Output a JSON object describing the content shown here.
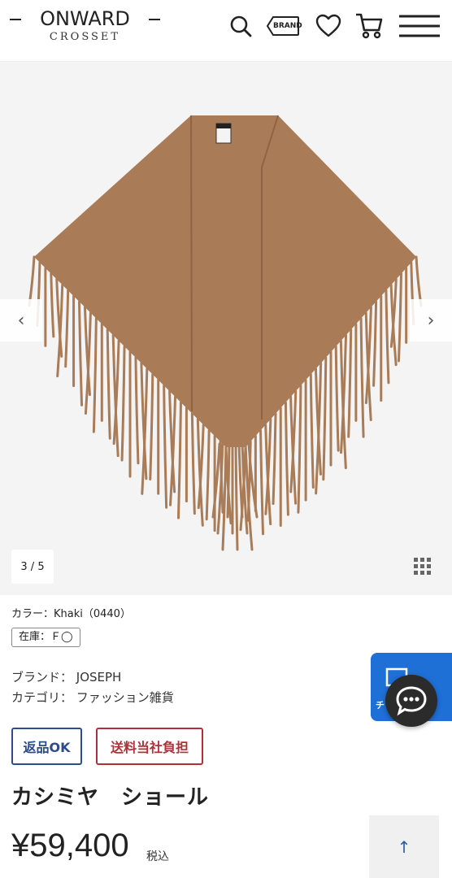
{
  "header": {
    "logo_main": "ONWARD",
    "logo_sub": "CROSSET",
    "brand_label": "BRAND",
    "icons": [
      "search-icon",
      "brand-icon",
      "heart-icon",
      "cart-icon",
      "menu-icon"
    ]
  },
  "gallery": {
    "counter": "3 / 5",
    "prev_label": "‹",
    "next_label": "›",
    "shawl_color": "#a97c57"
  },
  "product": {
    "color_line": "カラー：Khaki（0440）",
    "stock": "在庫：Ｆ◯",
    "brand_line": "ブランド：  JOSEPH",
    "category_line": "カテゴリ：  ファッション雑貨",
    "return_label": "返品OK",
    "shipping_label": "送料当社負担",
    "name": "カシミヤ　ショール",
    "price": "¥59,400",
    "tax": "税込"
  },
  "floating": {
    "chat_panel_text": "チ",
    "to_top": "↑"
  },
  "colors": {
    "accent_blue": "#1e6fd6",
    "return_border": "#2d4c8a",
    "shipping_border": "#b0303a"
  }
}
